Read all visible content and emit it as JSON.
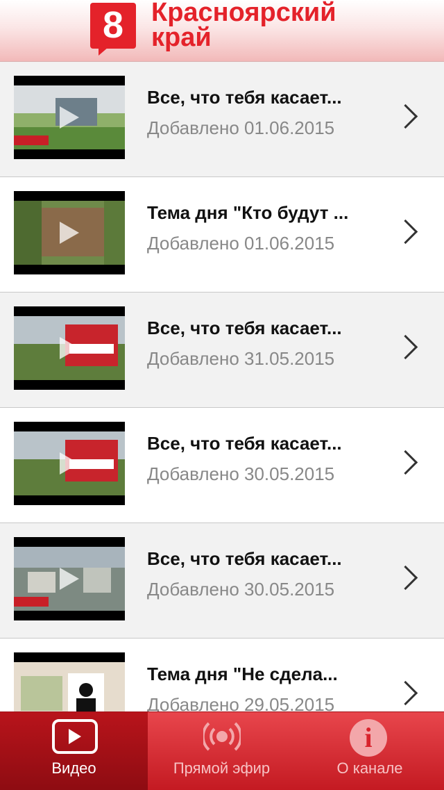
{
  "header": {
    "logo_number": "8",
    "title_line1": "Красноярский",
    "title_line2": "край"
  },
  "videos": [
    {
      "title": "Все, что тебя касает...",
      "date": "Добавлено 01.06.2015"
    },
    {
      "title": "Тема дня \"Кто будут ...",
      "date": "Добавлено 01.06.2015"
    },
    {
      "title": "Все, что тебя касает...",
      "date": "Добавлено 31.05.2015"
    },
    {
      "title": "Все, что тебя касает...",
      "date": "Добавлено 30.05.2015"
    },
    {
      "title": "Все, что тебя касает...",
      "date": "Добавлено 30.05.2015"
    },
    {
      "title": "Тема дня \"Не сдела...",
      "date": "Добавлено 29.05.2015"
    }
  ],
  "tabbar": {
    "video_label": "Видео",
    "live_label": "Прямой эфир",
    "about_label": "О канале",
    "about_icon_glyph": "i",
    "active": "video"
  },
  "colors": {
    "brand_red": "#e4222a",
    "tab_active": "#a0121a"
  }
}
